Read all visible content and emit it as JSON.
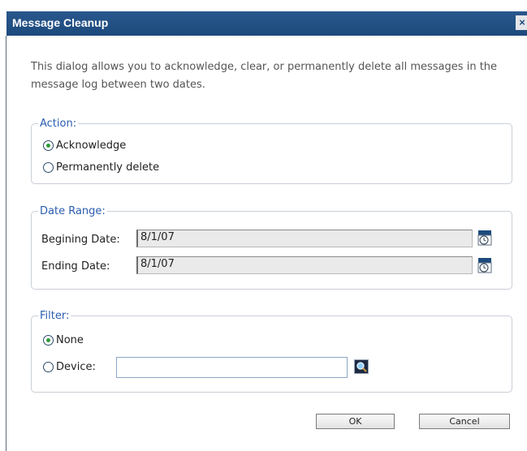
{
  "dialog": {
    "title": "Message Cleanup",
    "close_label": "×",
    "description": "This dialog allows you to acknowledge, clear, or permanently delete all messages in the message log between two dates."
  },
  "action": {
    "legend": "Action:",
    "options": [
      {
        "label": "Acknowledge",
        "selected": true
      },
      {
        "label": "Permanently delete",
        "selected": false
      }
    ]
  },
  "date_range": {
    "legend": "Date Range:",
    "beginning_label": "Begining Date:",
    "beginning_value": "8/1/07",
    "ending_label": "Ending Date:",
    "ending_value": "8/1/07"
  },
  "filter": {
    "legend": "Filter:",
    "options": [
      {
        "label": "None",
        "selected": true
      },
      {
        "label": "Device:",
        "selected": false
      }
    ],
    "device_value": ""
  },
  "buttons": {
    "ok": "OK",
    "cancel": "Cancel"
  },
  "colors": {
    "titlebar": "#1d4a7c",
    "legend": "#2a5db0",
    "radio_selected": "#2e9a3a"
  },
  "icons": [
    "calendar-icon",
    "search-icon",
    "close-icon"
  ]
}
